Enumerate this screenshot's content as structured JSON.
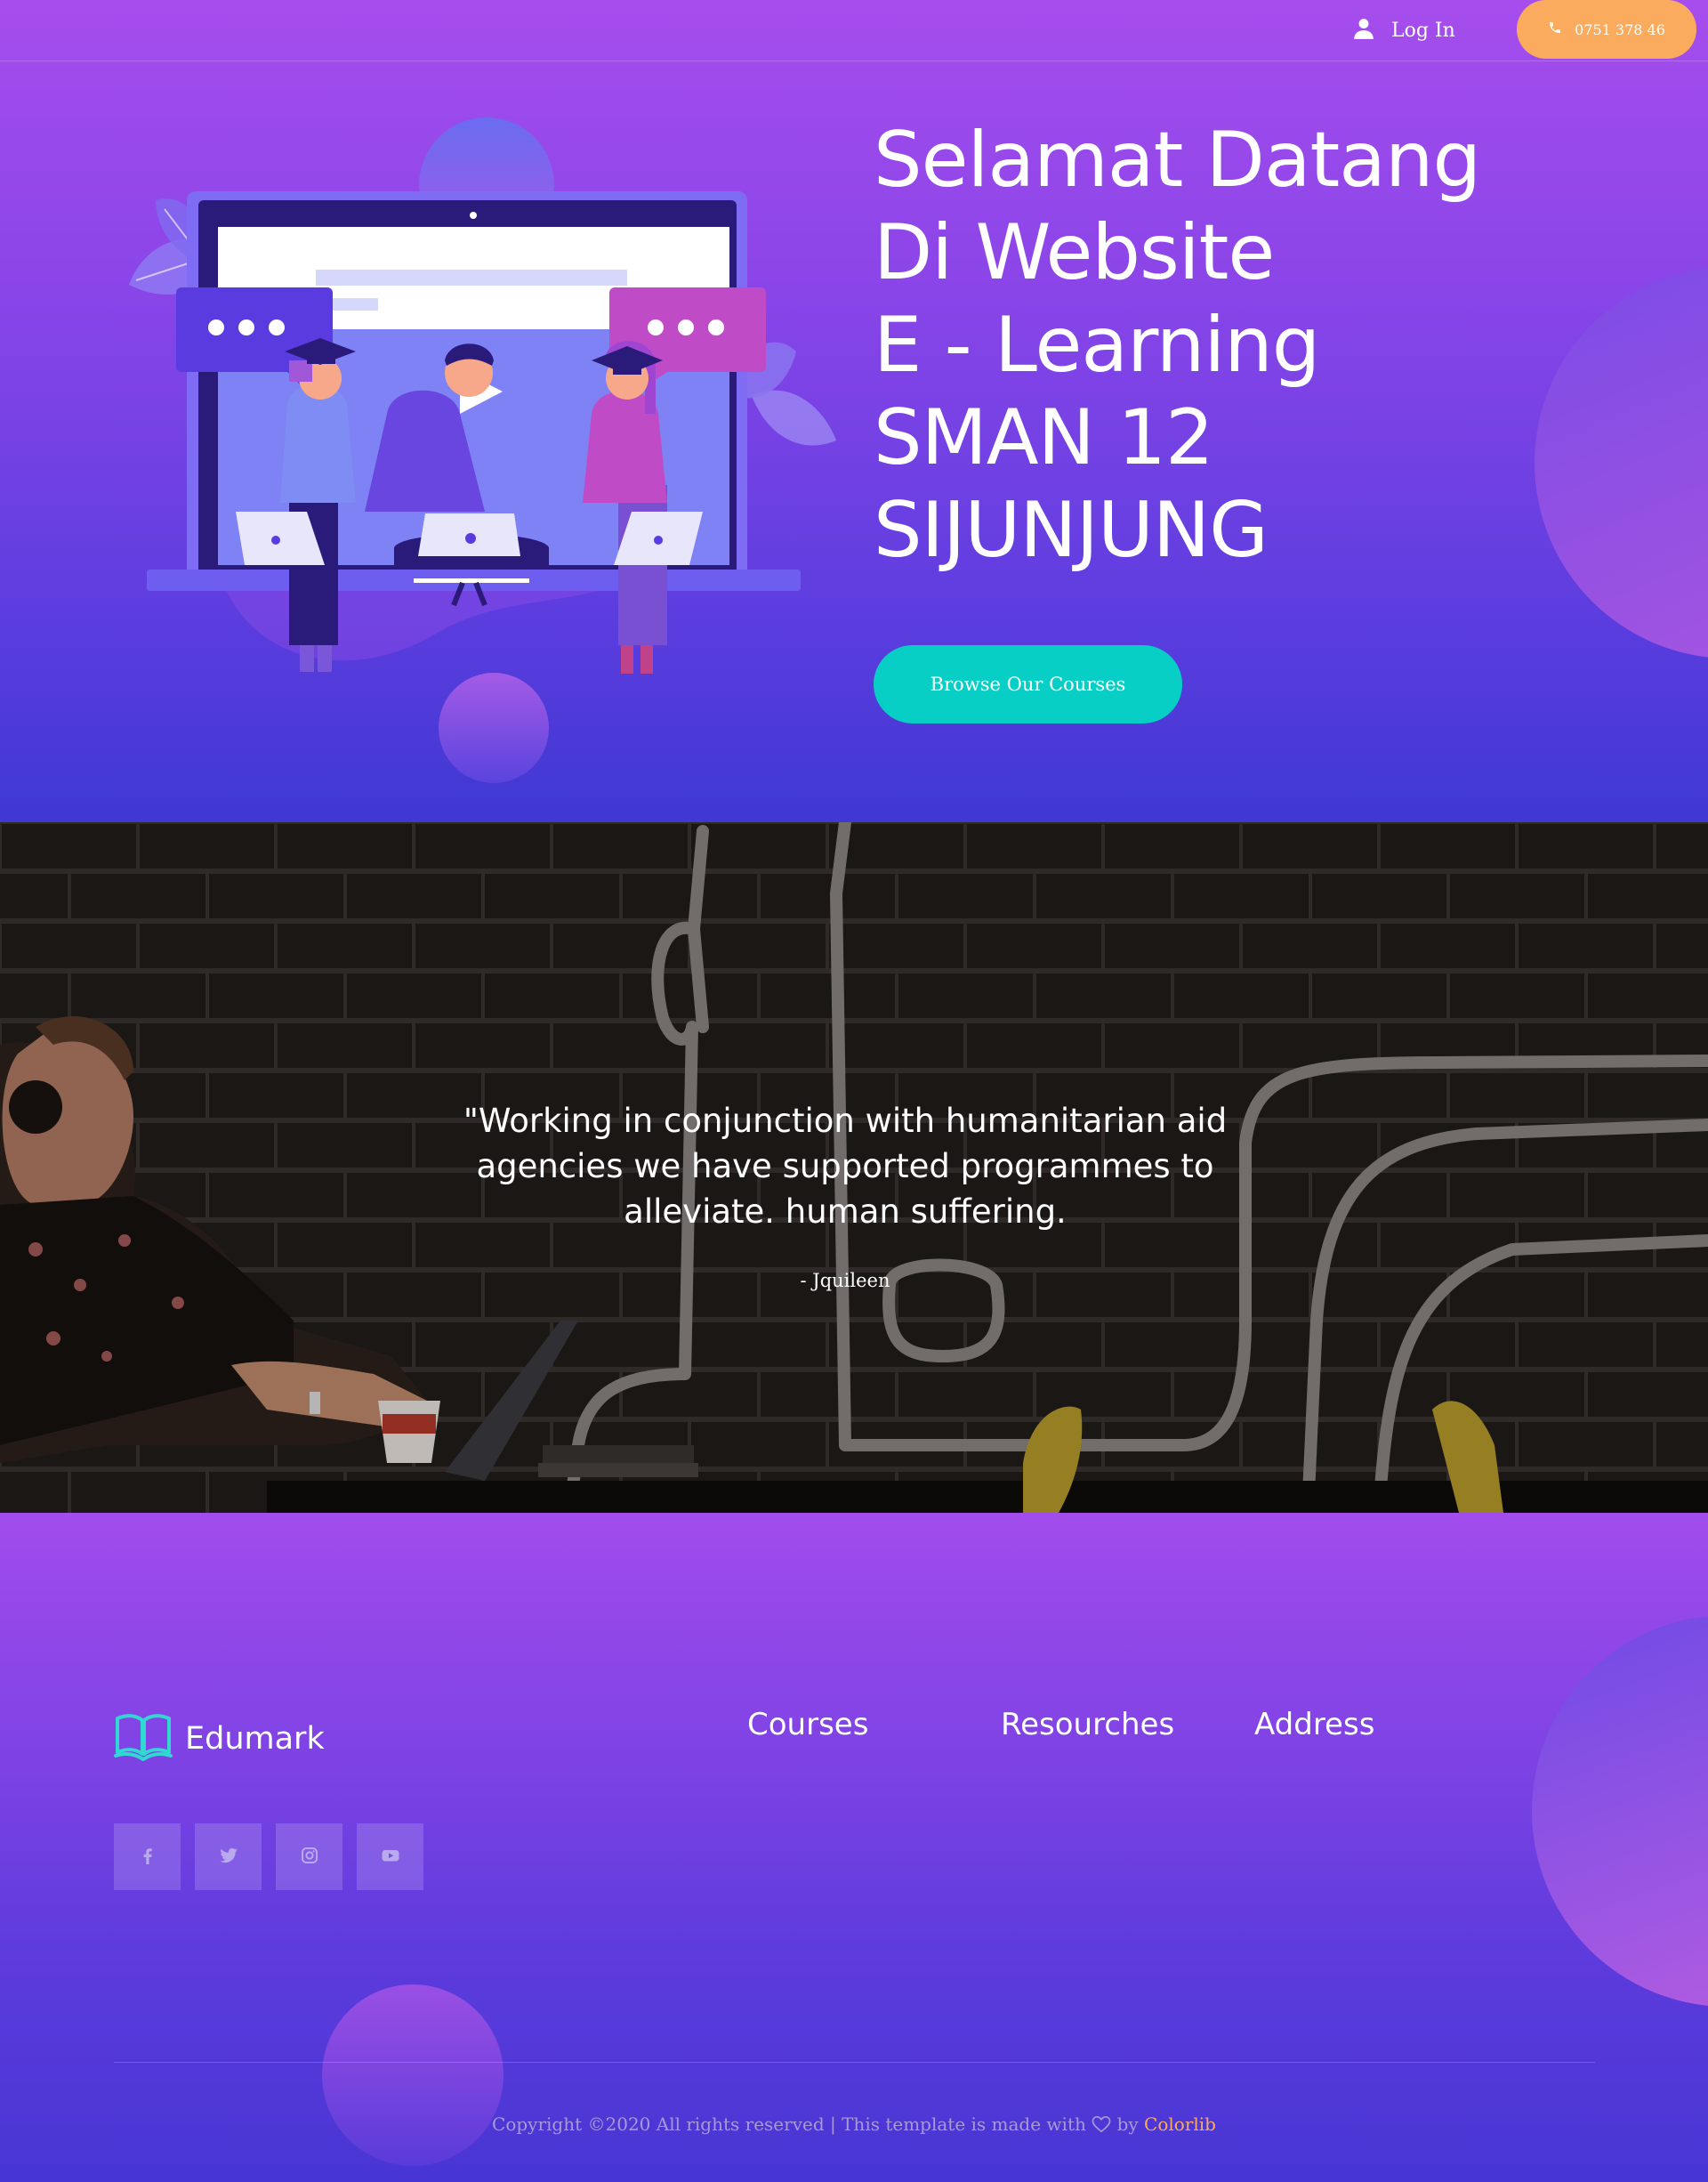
{
  "topbar": {
    "login_label": "Log In",
    "phone_label": "0751 378 46"
  },
  "hero": {
    "title_lines": [
      "Selamat Datang",
      "Di Website",
      "E - Learning",
      "SMAN 12",
      "SIJUNJUNG"
    ],
    "cta_label": "Browse Our Courses"
  },
  "quote": {
    "text": "\"Working in conjunction with humanitarian aid agencies we have supported programmes to alleviate. human suffering.",
    "author": "- Jquileen"
  },
  "footer": {
    "logo_text": "Edumark",
    "columns": [
      "Courses",
      "Resourches",
      "Address"
    ],
    "social": [
      "facebook-icon",
      "twitter-icon",
      "instagram-icon",
      "youtube-icon"
    ],
    "copyright_prefix": "Copyright ©2020 All rights reserved | This template is made with",
    "copyright_by": "by",
    "copyright_brand": "Colorlib"
  },
  "colors": {
    "accent_orange": "#fbab5e",
    "accent_teal": "#08cfc5",
    "hero_purple": "#a64ded",
    "deep_blue": "#3f38d2"
  }
}
